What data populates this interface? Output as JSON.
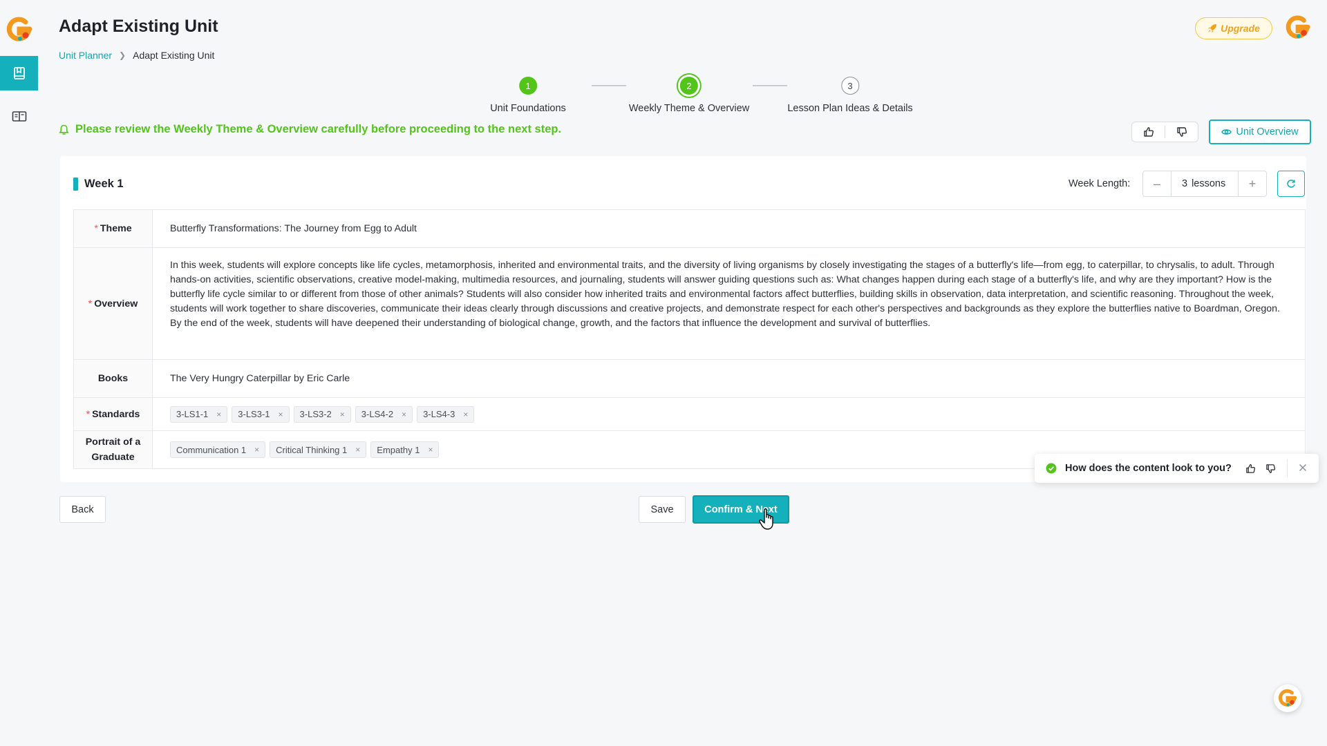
{
  "header": {
    "title": "Adapt Existing Unit",
    "breadcrumb": {
      "parent": "Unit Planner",
      "current": "Adapt Existing Unit"
    },
    "upgrade_label": "Upgrade"
  },
  "steps": [
    {
      "number": "1",
      "label": "Unit Foundations",
      "status": "done"
    },
    {
      "number": "2",
      "label": "Weekly Theme & Overview",
      "status": "current"
    },
    {
      "number": "3",
      "label": "Lesson Plan Ideas & Details",
      "status": "todo"
    }
  ],
  "notice": "Please review the Weekly Theme & Overview carefully before proceeding to the next step.",
  "unit_overview_label": "Unit Overview",
  "week": {
    "title": "Week 1",
    "length_label": "Week Length:",
    "length_value": "3",
    "length_unit": "lessons",
    "fields": {
      "theme_label": "Theme",
      "theme_value": "Butterfly Transformations: The Journey from Egg to Adult",
      "overview_label": "Overview",
      "overview_value": "In this week, students will explore concepts like life cycles, metamorphosis, inherited and environmental traits, and the diversity of living organisms by closely investigating the stages of a butterfly's life—from egg, to caterpillar, to chrysalis, to adult. Through hands-on activities, scientific observations, creative model-making, multimedia resources, and journaling, students will answer guiding questions such as: What changes happen during each stage of a butterfly's life, and why are they important? How is the butterfly life cycle similar to or different from those of other animals? Students will also consider how inherited traits and environmental factors affect butterflies, building skills in observation, data interpretation, and scientific reasoning. Throughout the week, students will work together to share discoveries, communicate their ideas clearly through discussions and creative projects, and demonstrate respect for each other's perspectives and backgrounds as they explore the butterflies native to Boardman, Oregon. By the end of the week, students will have deepened their understanding of biological change, growth, and the factors that influence the development and survival of butterflies.",
      "books_label": "Books",
      "books_value": "The Very Hungry Caterpillar by Eric Carle",
      "standards_label": "Standards",
      "standards": [
        "3-LS1-1",
        "3-LS3-1",
        "3-LS3-2",
        "3-LS4-2",
        "3-LS4-3"
      ],
      "portrait_label": "Portrait of a Graduate",
      "portrait": [
        "Communication 1",
        "Critical Thinking 1",
        "Empathy 1"
      ]
    }
  },
  "buttons": {
    "back": "Back",
    "save": "Save",
    "confirm": "Confirm & Next"
  },
  "toast": {
    "message": "How does the content look to you?"
  },
  "colors": {
    "accent": "#14b1bd",
    "success": "#52c41a",
    "required": "#ff4d4f",
    "upgrade": "#f0a31a"
  }
}
